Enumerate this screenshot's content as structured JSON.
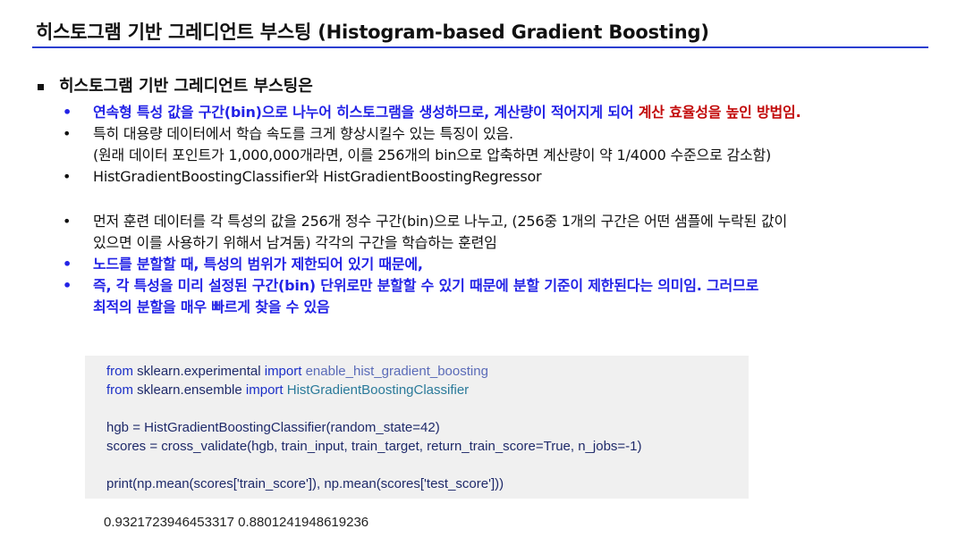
{
  "title": "히스토그램 기반 그레디언트 부스팅 (Histogram-based Gradient Boosting)",
  "heading": "히스토그램 기반 그레디언트 부스팅은",
  "bullets": [
    {
      "pre": "연속형 특성 값을 구간(bin)으로 나누어 히스토그램을 생성하므로, 계산량이 적어지게 되어 ",
      "emph": "계산 효율성을 높인 방법임."
    },
    {
      "line1": "특히 대용량 데이터에서 학습 속도를 크게 향상시킬수 있는 특징이 있음.",
      "line2": "(원래 데이터 포인트가 1,000,000개라면, 이를 256개의 bin으로 압축하면 계산량이 약 1/4000 수준으로 감소함)"
    },
    {
      "text": "HistGradientBoostingClassifier와 HistGradientBoostingRegressor"
    },
    {
      "line1": "먼저 훈련 데이터를 각 특성의 값을  256개 정수 구간(bin)으로 나누고, (256중 1개의 구간은 어떤 샘플에 누락된 값이",
      "line2": "있으면 이를 사용하기 위해서 남겨둠) 각각의 구간을 학습하는 훈련임"
    },
    {
      "text": "노드를 분할할 때, 특성의 범위가 제한되어 있기 때문에,"
    },
    {
      "line1": "즉, 각 특성을 미리 설정된 구간(bin) 단위로만 분할할 수 있기 때문에 분할 기준이 제한된다는 의미임.  그러므로",
      "line2": "최적의 분할을 매우 빠르게 찾을 수 있음"
    }
  ],
  "bullet_symbol": "•",
  "code": {
    "l1": {
      "kw1": "from",
      "mod": " sklearn.experimental ",
      "kw2": "import",
      "name": " enable_hist_gradient_boosting"
    },
    "l2": {
      "kw1": "from",
      "mod": " sklearn.ensemble ",
      "kw2": "import",
      "name": " HistGradientBoostingClassifier"
    },
    "l3": "hgb = HistGradientBoostingClassifier(random_state=42)",
    "l4": "scores = cross_validate(hgb, train_input, train_target, return_train_score=True, n_jobs=-1)",
    "l5": "print(np.mean(scores['train_score']), np.mean(scores['test_score']))"
  },
  "output": "0.9321723946453317 0.8801241948619236",
  "colors": {
    "accent_blue": "#2323e6",
    "accent_red": "#c20a0a",
    "rule": "#2b3fd0",
    "code_bg": "#f0f0f0"
  }
}
